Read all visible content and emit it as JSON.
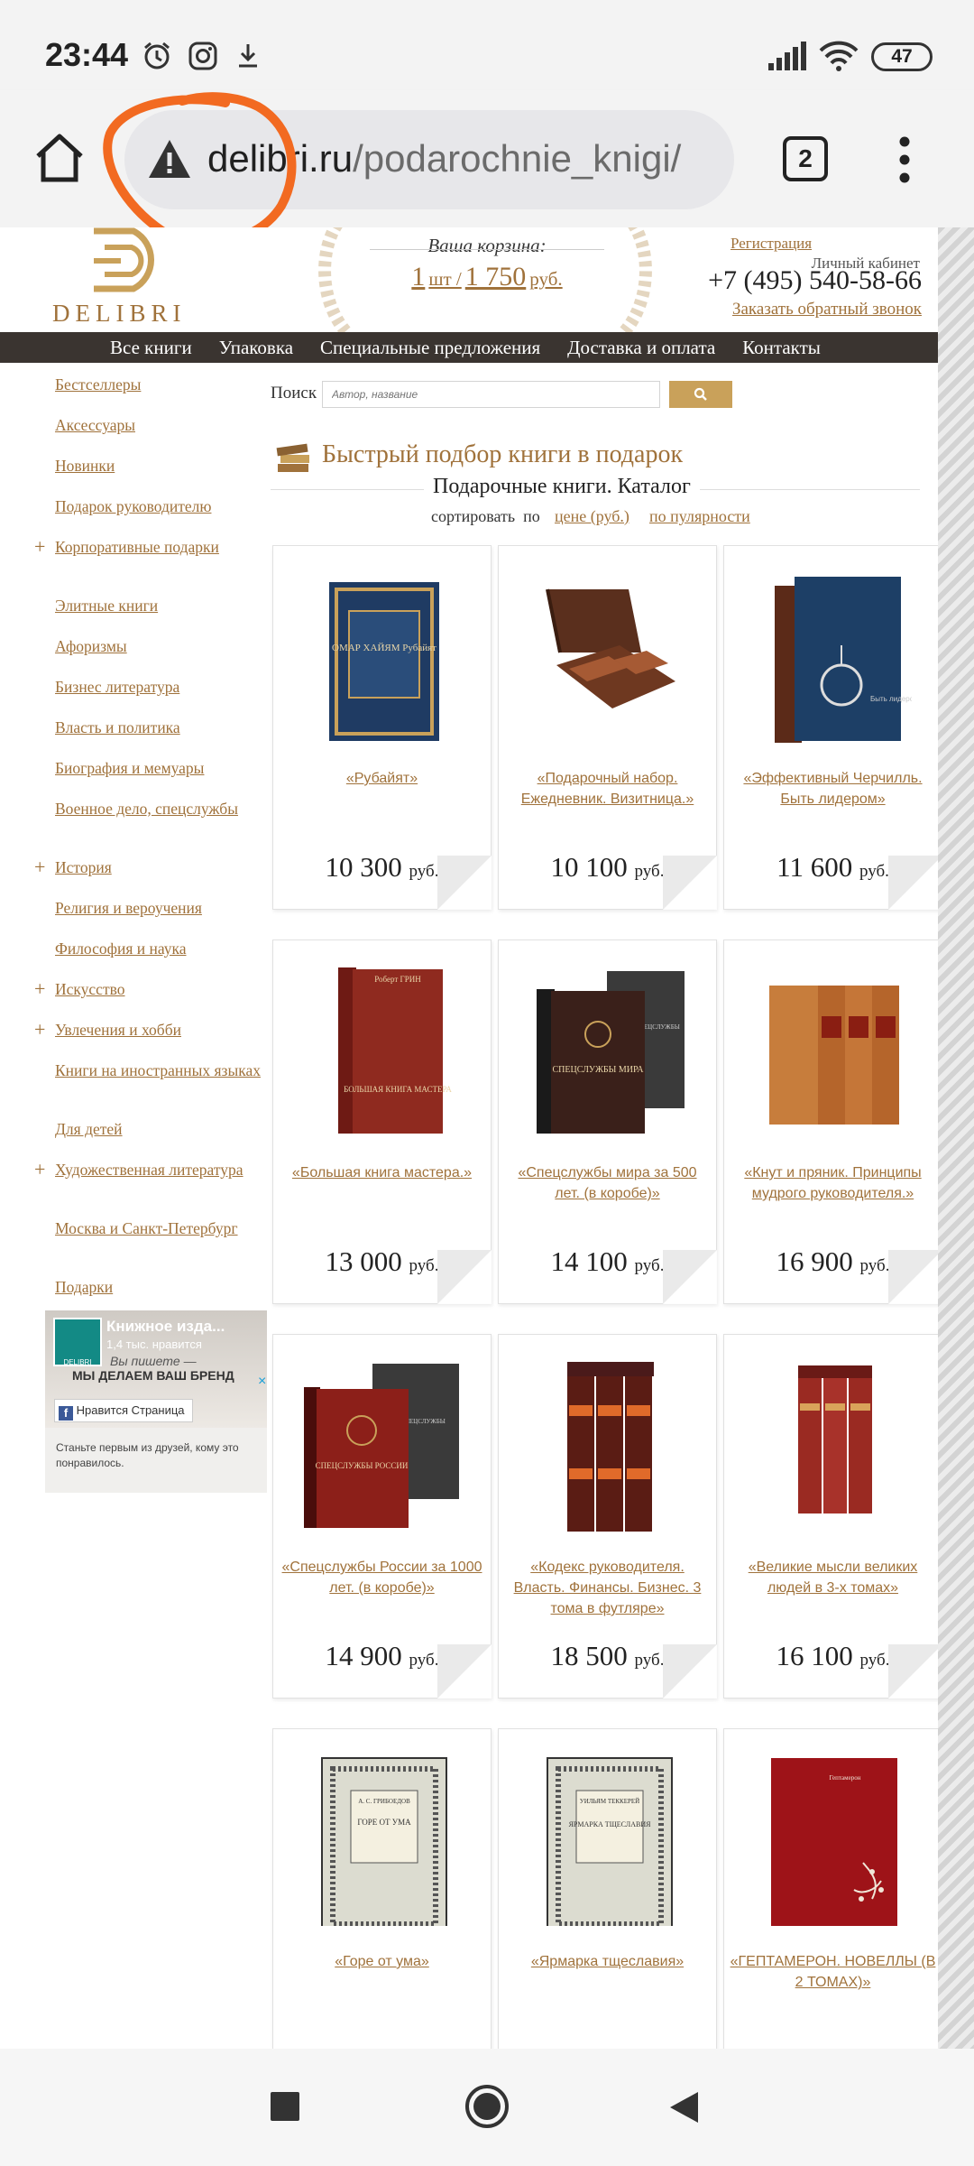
{
  "status_bar": {
    "time": "23:44",
    "battery": "47"
  },
  "browser": {
    "url_host": "delibri.ru",
    "url_path": "/podarochnie_knigi/",
    "tab_count": "2"
  },
  "header": {
    "logo_text": "DELIBRI",
    "cart_label": "Ваша корзина:",
    "cart_qty": "1",
    "cart_qty_unit": "шт /",
    "cart_sum": "1 750",
    "cart_sum_unit": "руб.",
    "register": "Регистрация",
    "cabinet": "Личный кабинет",
    "phone": "+7 (495) 540-58-66",
    "callback": "Заказать обратный звонок"
  },
  "nav": [
    "Все книги",
    "Упаковка",
    "Специальные предложения",
    "Доставка и оплата",
    "Контакты"
  ],
  "sidebar": [
    {
      "label": "Бестселлеры",
      "plus": false
    },
    {
      "label": "Аксессуары",
      "plus": false
    },
    {
      "label": "Новинки",
      "plus": false
    },
    {
      "label": "Подарок руководителю",
      "plus": false
    },
    {
      "label": "Корпоративные подарки",
      "plus": true
    },
    {
      "label": "Элитные книги",
      "plus": false
    },
    {
      "label": "Афоризмы",
      "plus": false
    },
    {
      "label": "Бизнес литература",
      "plus": false
    },
    {
      "label": "Власть и политика",
      "plus": false
    },
    {
      "label": "Биография и мемуары",
      "plus": false
    },
    {
      "label": "Военное дело, спецслужбы",
      "plus": false
    },
    {
      "label": "История",
      "plus": true
    },
    {
      "label": "Религия и вероучения",
      "plus": false
    },
    {
      "label": "Философия и наука",
      "plus": false
    },
    {
      "label": "Искусство",
      "plus": true
    },
    {
      "label": "Увлечения и хобби",
      "plus": true
    },
    {
      "label": "Книги на иностранных языках",
      "plus": false
    },
    {
      "label": "Для детей",
      "plus": false
    },
    {
      "label": "Художественная литература",
      "plus": true
    },
    {
      "label": "Москва и Санкт-Петербург",
      "plus": false
    },
    {
      "label": "Подарки",
      "plus": false
    }
  ],
  "fb_widget": {
    "page_name": "Книжное изда...",
    "likes": "1,4 тыс. нравится",
    "tag1": "Вы пишете —",
    "tag2": "МЫ ДЕЛАЕМ ВАШ БРЕНД",
    "like_button": "Нравится Страница",
    "prompt": "Станьте первым из друзей, кому это понравилось.",
    "logo_text": "DELIBRI"
  },
  "search": {
    "label": "Поиск",
    "placeholder": "Автор, название"
  },
  "promo_title": "Быстрый подбор книги в подарок",
  "catalog_title": "Подарочные книги. Каталог",
  "sort": {
    "label": "сортировать  по",
    "by_price": "цене (руб.)",
    "by_popularity": "по пулярности"
  },
  "products": [
    {
      "title": "«Рубайят»",
      "price": "10 300",
      "unit": "руб."
    },
    {
      "title": "«Подарочный набор. Ежедневник. Визитница.»",
      "price": "10 100",
      "unit": "руб."
    },
    {
      "title": "«Эффективный Черчилль. Быть лидером»",
      "price": "11 600",
      "unit": "руб."
    },
    {
      "title": "«Большая книга мастера.»",
      "price": "13 000",
      "unit": "руб."
    },
    {
      "title": "«Спецслужбы мира за 500 лет. (в коробе)»",
      "price": "14 100",
      "unit": "руб."
    },
    {
      "title": "«Кнут и пряник. Принципы мудрого руководителя.»",
      "price": "16 900",
      "unit": "руб."
    },
    {
      "title": "«Спецслужбы России за 1000 лет. (в коробе)»",
      "price": "14 900",
      "unit": "руб."
    },
    {
      "title": "«Кодекс руководителя. Власть. Финансы. Бизнес. 3 тома в футляре»",
      "price": "18 500",
      "unit": "руб."
    },
    {
      "title": "«Великие мысли великих людей в 3-х томах»",
      "price": "16 100",
      "unit": "руб."
    },
    {
      "title": "«Горе от ума»",
      "price": "",
      "unit": ""
    },
    {
      "title": "«Ярмарка тщеславия»",
      "price": "",
      "unit": ""
    },
    {
      "title": "«ГЕПТАМЕРОН. НОВЕЛЛЫ (В 2 ТОМАХ)»",
      "price": "",
      "unit": ""
    }
  ],
  "book_spines": {
    "b1_text": "ОМАР ХАЙЯМ Рубайят",
    "b3_text": "Быть лидером",
    "b4_top": "Роберт ГРИН",
    "b4_main": "БОЛЬШАЯ КНИГА МАСТЕРА",
    "b5_main": "СПЕЦСЛУЖБЫ МИРА",
    "b5_box": "СПЕЦСЛУЖБЫ",
    "b7_main": "СПЕЦСЛУЖБЫ РОССИИ",
    "b7_box": "СПЕЦСЛУЖБЫ",
    "b10_top": "А. С. ГРИБОЕДОВ",
    "b10_main": "ГОРЕ ОТ УМА",
    "b11_top": "УИЛЬЯМ ТЕККЕРЕЙ",
    "b11_main": "ЯРМАРКА ТЩЕСЛАВИЯ",
    "b12_main": "Гептамерон"
  },
  "colors": {
    "accent": "#a0723b",
    "nav_bg": "#3a3430",
    "search_btn": "#c9a15a",
    "annotation": "#f26a21"
  }
}
